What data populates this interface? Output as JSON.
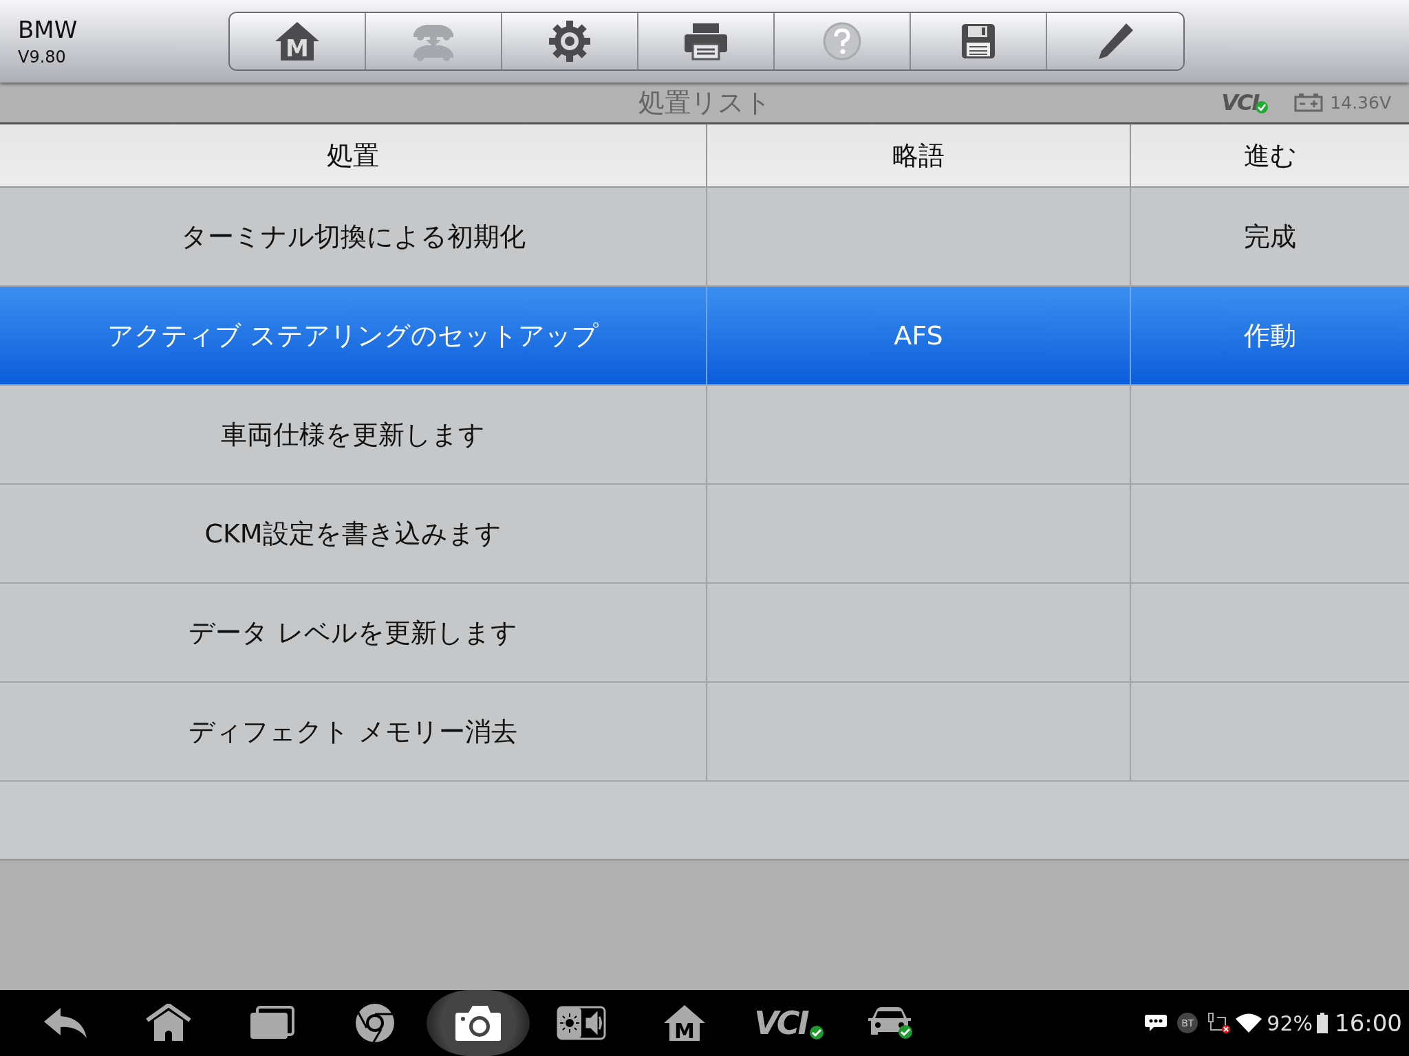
{
  "app": {
    "name": "BMW",
    "version": "V9.80"
  },
  "toolbar": [
    {
      "kind": "home",
      "label": "M",
      "disabled": false
    },
    {
      "kind": "car-transfer",
      "disabled": true
    },
    {
      "kind": "settings",
      "disabled": false
    },
    {
      "kind": "print",
      "disabled": false
    },
    {
      "kind": "help",
      "disabled": true
    },
    {
      "kind": "save",
      "disabled": false
    },
    {
      "kind": "edit",
      "disabled": false
    }
  ],
  "title_bar": {
    "title": "処置リスト",
    "vci_label": "VCI",
    "vci_connected": true,
    "voltage": "14.36V"
  },
  "table": {
    "columns": [
      "処置",
      "略語",
      "進む"
    ],
    "rows": [
      {
        "cells": [
          "ターミナル切換による初期化",
          "",
          "完成"
        ],
        "selected": false
      },
      {
        "cells": [
          "アクティブ ステアリングのセットアップ",
          "AFS",
          "作動"
        ],
        "selected": true
      },
      {
        "cells": [
          "車両仕様を更新します",
          "",
          ""
        ],
        "selected": false
      },
      {
        "cells": [
          "CKM設定を書き込みます",
          "",
          ""
        ],
        "selected": false
      },
      {
        "cells": [
          "データ レベルを更新します",
          "",
          ""
        ],
        "selected": false
      },
      {
        "cells": [
          "ディフェクト メモリー消去",
          "",
          ""
        ],
        "selected": false
      }
    ]
  },
  "nav_bar": {
    "buttons": [
      {
        "kind": "back",
        "selected": false
      },
      {
        "kind": "home",
        "selected": false
      },
      {
        "kind": "recent",
        "selected": false
      },
      {
        "kind": "browser",
        "selected": false
      },
      {
        "kind": "camera",
        "selected": true
      },
      {
        "kind": "display-volume",
        "selected": false
      },
      {
        "kind": "m-home",
        "label": "M",
        "selected": false
      },
      {
        "kind": "vci",
        "label": "VCI",
        "selected": false
      },
      {
        "kind": "car",
        "selected": false
      }
    ],
    "status": {
      "bt": "BT",
      "battery": "92%",
      "time": "16:00"
    }
  }
}
